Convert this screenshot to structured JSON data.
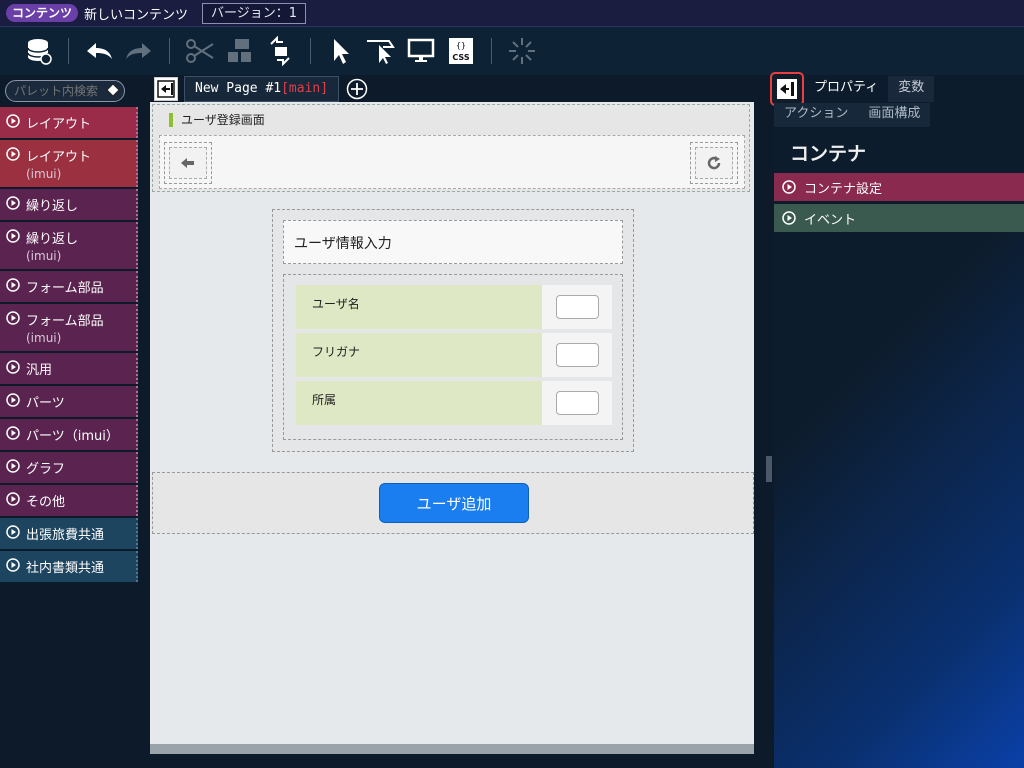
{
  "titlebar": {
    "badge": "コンテンツ",
    "title": "新しいコンテンツ",
    "version": "バージョン：1"
  },
  "toolbar": {
    "buttons": [
      "database-icon",
      "undo-icon",
      "redo-icon",
      "cut-icon",
      "group-icon",
      "ungroup-icon",
      "select-icon",
      "select-region-icon",
      "preview-icon",
      "css-icon",
      "spinner-icon"
    ],
    "css_label": "CSS"
  },
  "palette": {
    "search_placeholder": "パレット内検索",
    "items": [
      {
        "label": "レイアウト",
        "sub": ""
      },
      {
        "label": "レイアウト",
        "sub": "(imui)"
      },
      {
        "label": "繰り返し",
        "sub": ""
      },
      {
        "label": "繰り返し",
        "sub": "(imui)"
      },
      {
        "label": "フォーム部品",
        "sub": ""
      },
      {
        "label": "フォーム部品",
        "sub": "(imui)"
      },
      {
        "label": "汎用",
        "sub": ""
      },
      {
        "label": "パーツ",
        "sub": ""
      },
      {
        "label": "パーツ（imui）",
        "sub": ""
      },
      {
        "label": "グラフ",
        "sub": ""
      },
      {
        "label": "その他",
        "sub": ""
      },
      {
        "label": "出張旅費共通",
        "sub": ""
      },
      {
        "label": "社内書類共通",
        "sub": ""
      }
    ]
  },
  "pagetab": {
    "name": "New Page #1",
    "tag": "[main]"
  },
  "canvas": {
    "header_title": "ユーザ登録画面",
    "form_title": "ユーザ情報入力",
    "fields": [
      "ユーザ名",
      "フリガナ",
      "所属"
    ],
    "add_button": "ユーザ追加"
  },
  "rpanel": {
    "tabs": [
      "プロパティ",
      "変数"
    ],
    "subtabs": [
      "アクション",
      "画面構成"
    ],
    "heading": "コンテナ",
    "sections": [
      "コンテナ設定",
      "イベント"
    ]
  }
}
